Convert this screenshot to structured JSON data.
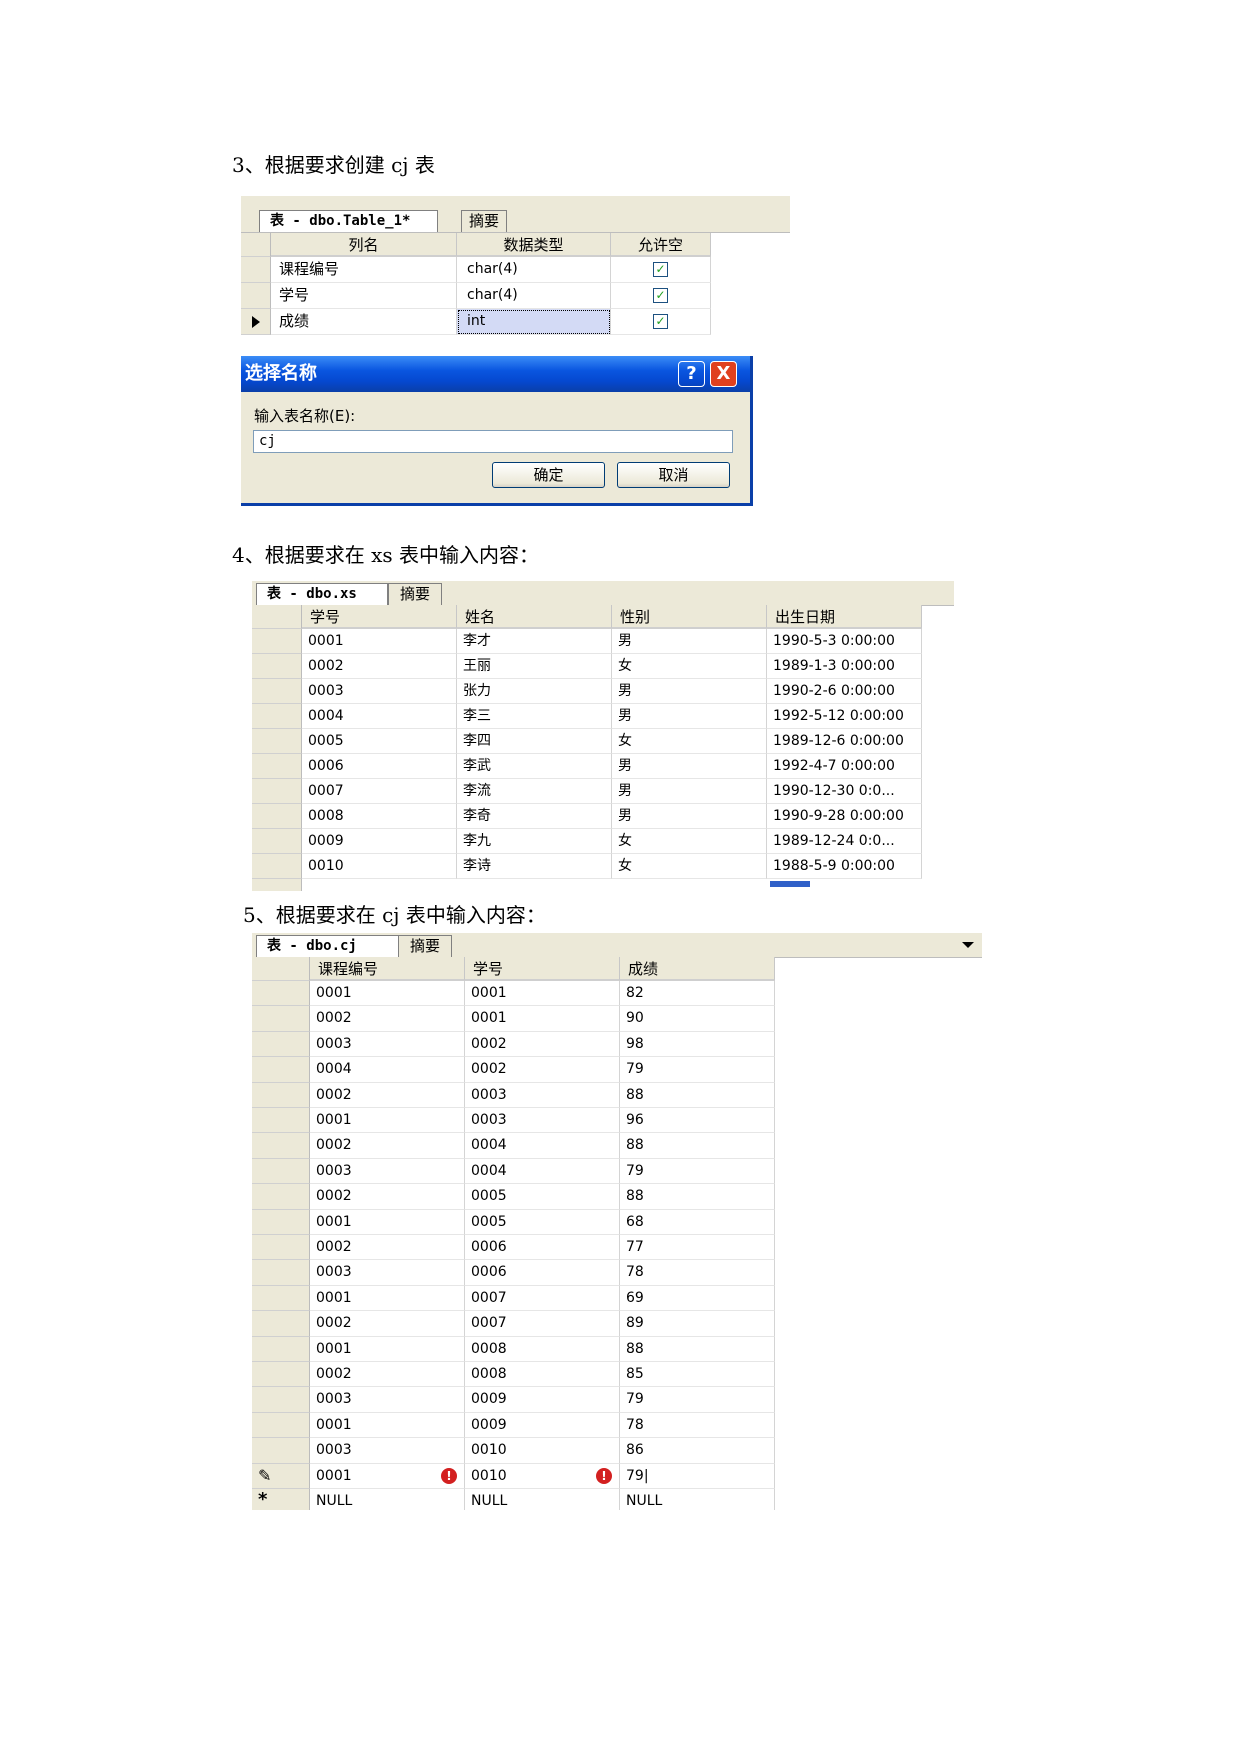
{
  "headings": {
    "h3": "3、根据要求创建 cj 表",
    "h4": "4、根据要求在 xs 表中输入内容：",
    "h5": "5、根据要求在 cj 表中输入内容："
  },
  "design_panel": {
    "tab_label": "表 - dbo.Table_1*",
    "summary_tab": "摘要",
    "columns": [
      "列名",
      "数据类型",
      "允许空"
    ],
    "rows": [
      {
        "name": "课程编号",
        "type": "char(4)",
        "nullable": true
      },
      {
        "name": "学号",
        "type": "char(4)",
        "nullable": true
      },
      {
        "name": "成绩",
        "type": "int",
        "nullable": true
      }
    ]
  },
  "dialog": {
    "title": "选择名称",
    "help_icon": "?",
    "close_icon": "X",
    "label": "输入表名称(E):",
    "input_value": "cj",
    "ok_label": "确定",
    "cancel_label": "取消"
  },
  "xs_table": {
    "tab_label": "表 - dbo.xs",
    "summary_tab": "摘要",
    "columns": [
      "学号",
      "姓名",
      "性别",
      "出生日期"
    ],
    "rows": [
      [
        "0001",
        "李才",
        "男",
        "1990-5-3 0:00:00"
      ],
      [
        "0002",
        "王丽",
        "女",
        "1989-1-3 0:00:00"
      ],
      [
        "0003",
        "张力",
        "男",
        "1990-2-6 0:00:00"
      ],
      [
        "0004",
        "李三",
        "男",
        "1992-5-12 0:00:00"
      ],
      [
        "0005",
        "李四",
        "女",
        "1989-12-6 0:00:00"
      ],
      [
        "0006",
        "李武",
        "男",
        "1992-4-7 0:00:00"
      ],
      [
        "0007",
        "李流",
        "男",
        "1990-12-30 0:0..."
      ],
      [
        "0008",
        "李奇",
        "男",
        "1990-9-28 0:00:00"
      ],
      [
        "0009",
        "李九",
        "女",
        "1989-12-24 0:0..."
      ],
      [
        "0010",
        "李诗",
        "女",
        "1988-5-9 0:00:00"
      ]
    ]
  },
  "cj_table": {
    "tab_label": "表 - dbo.cj",
    "summary_tab": "摘要",
    "columns": [
      "课程编号",
      "学号",
      "成绩"
    ],
    "rows": [
      [
        "0001",
        "0001",
        "82"
      ],
      [
        "0002",
        "0001",
        "90"
      ],
      [
        "0003",
        "0002",
        "98"
      ],
      [
        "0004",
        "0002",
        "79"
      ],
      [
        "0002",
        "0003",
        "88"
      ],
      [
        "0001",
        "0003",
        "96"
      ],
      [
        "0002",
        "0004",
        "88"
      ],
      [
        "0003",
        "0004",
        "79"
      ],
      [
        "0002",
        "0005",
        "88"
      ],
      [
        "0001",
        "0005",
        "68"
      ],
      [
        "0002",
        "0006",
        "77"
      ],
      [
        "0003",
        "0006",
        "78"
      ],
      [
        "0001",
        "0007",
        "69"
      ],
      [
        "0002",
        "0007",
        "89"
      ],
      [
        "0001",
        "0008",
        "88"
      ],
      [
        "0002",
        "0008",
        "85"
      ],
      [
        "0003",
        "0009",
        "79"
      ],
      [
        "0001",
        "0009",
        "78"
      ],
      [
        "0003",
        "0010",
        "86"
      ],
      [
        "0001",
        "0010",
        "79|"
      ]
    ],
    "new_row_marker": "*",
    "edit_marker": "✎",
    "null_placeholder": "NULL",
    "error_icon": "!"
  }
}
